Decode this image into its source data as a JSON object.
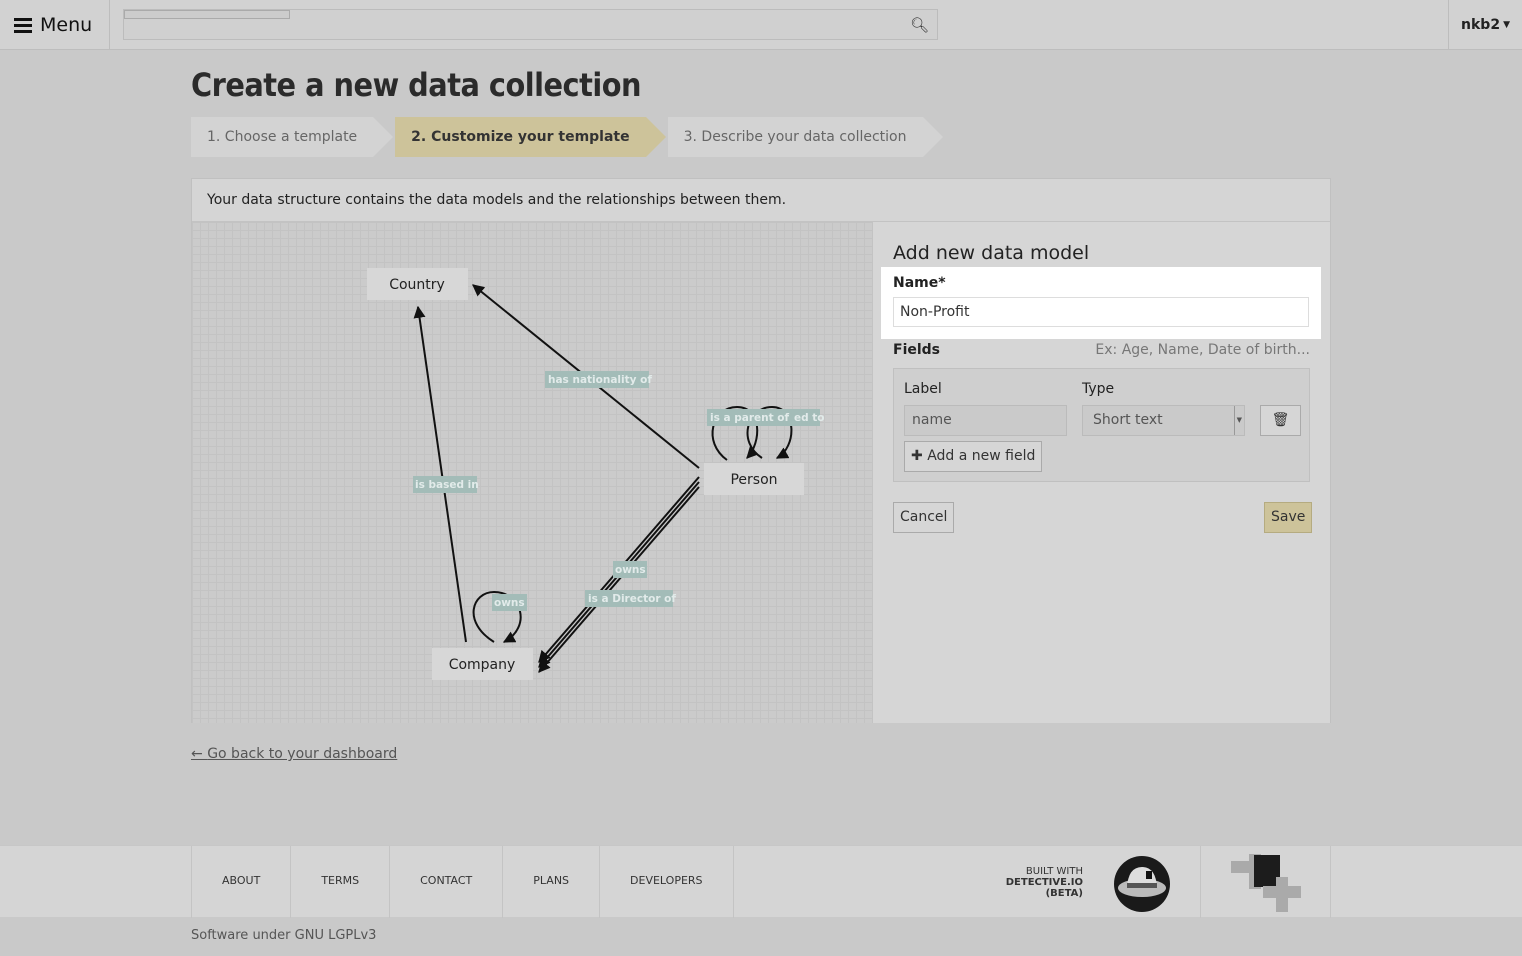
{
  "topbar": {
    "menu_label": "Menu",
    "user": "nkb2",
    "search_placeholder": ""
  },
  "page_title": "Create a new data collection",
  "steps": [
    {
      "label": "1. Choose a template",
      "active": false
    },
    {
      "label": "2. Customize your template",
      "active": true
    },
    {
      "label": "3. Describe your data collection",
      "active": false
    }
  ],
  "panel": {
    "intro": "Your data structure contains the data models and the relationships between them."
  },
  "diagram": {
    "nodes": [
      "Country",
      "Person",
      "Company"
    ],
    "edge_labels": {
      "nationality": "has nationality of",
      "parent": "is a parent of",
      "married": "ed to",
      "based": "is based in",
      "owns_self": "owns",
      "owns": "owns",
      "director": "is a Director of"
    }
  },
  "form": {
    "title": "Add new data model",
    "name_label": "Name*",
    "name_value": "Non-Profit",
    "fields_label": "Fields",
    "fields_hint": "Ex: Age, Name, Date of birth...",
    "col_label": "Label",
    "col_type": "Type",
    "field_label_value": "name",
    "field_type_value": "Short text",
    "add_field": "Add a new field",
    "cancel": "Cancel",
    "save": "Save"
  },
  "back_link": "Go back to your dashboard",
  "footer": {
    "nav": [
      "ABOUT",
      "TERMS",
      "CONTACT",
      "PLANS",
      "DEVELOPERS"
    ],
    "built1": "BUILT WITH",
    "built2": "DETECTIVE.IO",
    "built3": "(BETA)",
    "license": "Software under GNU LGPLv3"
  },
  "colors": {
    "accent": "#cdc39a",
    "edge_label": "#a3bcb8"
  }
}
